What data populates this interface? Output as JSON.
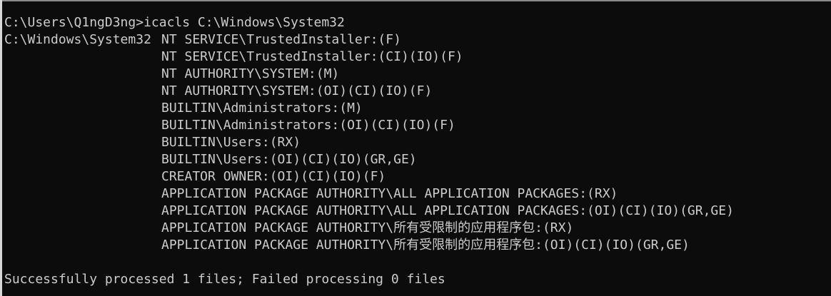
{
  "prompt_line": "C:\\Users\\Q1ngD3ng>icacls C:\\Windows\\System32",
  "target_path": "C:\\Windows\\System32",
  "acl_entries": [
    "NT SERVICE\\TrustedInstaller:(F)",
    "NT SERVICE\\TrustedInstaller:(CI)(IO)(F)",
    "NT AUTHORITY\\SYSTEM:(M)",
    "NT AUTHORITY\\SYSTEM:(OI)(CI)(IO)(F)",
    "BUILTIN\\Administrators:(M)",
    "BUILTIN\\Administrators:(OI)(CI)(IO)(F)",
    "BUILTIN\\Users:(RX)",
    "BUILTIN\\Users:(OI)(CI)(IO)(GR,GE)",
    "CREATOR OWNER:(OI)(CI)(IO)(F)",
    "APPLICATION PACKAGE AUTHORITY\\ALL APPLICATION PACKAGES:(RX)",
    "APPLICATION PACKAGE AUTHORITY\\ALL APPLICATION PACKAGES:(OI)(CI)(IO)(GR,GE)",
    "APPLICATION PACKAGE AUTHORITY\\所有受限制的应用程序包:(RX)",
    "APPLICATION PACKAGE AUTHORITY\\所有受限制的应用程序包:(OI)(CI)(IO)(GR,GE)"
  ],
  "summary_line": "Successfully processed 1 files; Failed processing 0 files",
  "colors": {
    "background": "#0c0c0c",
    "text": "#cccccc"
  }
}
